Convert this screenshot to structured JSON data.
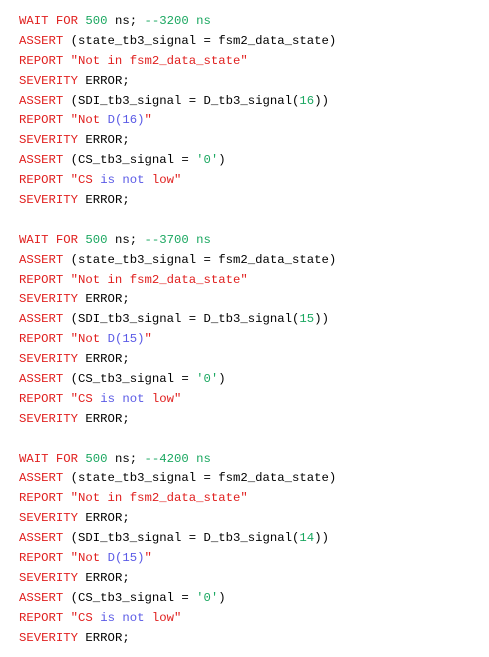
{
  "editor": {
    "lines": [
      [
        {
          "t": "WAIT FOR ",
          "c": "kw"
        },
        {
          "t": "500",
          "c": "num"
        },
        {
          "t": " ns",
          "c": "id"
        },
        {
          "t": "; ",
          "c": "op"
        },
        {
          "t": "--3200 ns",
          "c": "cmt"
        }
      ],
      [
        {
          "t": "ASSERT ",
          "c": "kw"
        },
        {
          "t": "(state_tb3_signal = fsm2_data_state)",
          "c": "id"
        }
      ],
      [
        {
          "t": "REPORT ",
          "c": "kw"
        },
        {
          "t": "\"Not in fsm2_data_state\"",
          "c": "str"
        }
      ],
      [
        {
          "t": "SEVERITY ",
          "c": "kw"
        },
        {
          "t": "ERROR",
          "c": "id"
        },
        {
          "t": ";",
          "c": "op"
        }
      ],
      [
        {
          "t": "ASSERT ",
          "c": "kw"
        },
        {
          "t": "(SDI_tb3_signal = D_tb3_signal(",
          "c": "id"
        },
        {
          "t": "16",
          "c": "num"
        },
        {
          "t": "))",
          "c": "id"
        }
      ],
      [
        {
          "t": "REPORT ",
          "c": "kw"
        },
        {
          "t": "\"Not ",
          "c": "str"
        },
        {
          "t": "D(16)",
          "c": "sd"
        },
        {
          "t": "\"",
          "c": "str"
        }
      ],
      [
        {
          "t": "SEVERITY ",
          "c": "kw"
        },
        {
          "t": "ERROR",
          "c": "id"
        },
        {
          "t": ";",
          "c": "op"
        }
      ],
      [
        {
          "t": "ASSERT ",
          "c": "kw"
        },
        {
          "t": "(CS_tb3_signal = ",
          "c": "id"
        },
        {
          "t": "'0'",
          "c": "num"
        },
        {
          "t": ")",
          "c": "id"
        }
      ],
      [
        {
          "t": "REPORT ",
          "c": "kw"
        },
        {
          "t": "\"CS ",
          "c": "str"
        },
        {
          "t": "is not",
          "c": "sd"
        },
        {
          "t": " low\"",
          "c": "str"
        }
      ],
      [
        {
          "t": "SEVERITY ",
          "c": "kw"
        },
        {
          "t": "ERROR",
          "c": "id"
        },
        {
          "t": ";",
          "c": "op"
        }
      ],
      [],
      [
        {
          "t": "WAIT FOR ",
          "c": "kw"
        },
        {
          "t": "500",
          "c": "num"
        },
        {
          "t": " ns",
          "c": "id"
        },
        {
          "t": "; ",
          "c": "op"
        },
        {
          "t": "--3700 ns",
          "c": "cmt"
        }
      ],
      [
        {
          "t": "ASSERT ",
          "c": "kw"
        },
        {
          "t": "(state_tb3_signal = fsm2_data_state)",
          "c": "id"
        }
      ],
      [
        {
          "t": "REPORT ",
          "c": "kw"
        },
        {
          "t": "\"Not in fsm2_data_state\"",
          "c": "str"
        }
      ],
      [
        {
          "t": "SEVERITY ",
          "c": "kw"
        },
        {
          "t": "ERROR",
          "c": "id"
        },
        {
          "t": ";",
          "c": "op"
        }
      ],
      [
        {
          "t": "ASSERT ",
          "c": "kw"
        },
        {
          "t": "(SDI_tb3_signal = D_tb3_signal(",
          "c": "id"
        },
        {
          "t": "15",
          "c": "num"
        },
        {
          "t": "))",
          "c": "id"
        }
      ],
      [
        {
          "t": "REPORT ",
          "c": "kw"
        },
        {
          "t": "\"Not ",
          "c": "str"
        },
        {
          "t": "D(15)",
          "c": "sd"
        },
        {
          "t": "\"",
          "c": "str"
        }
      ],
      [
        {
          "t": "SEVERITY ",
          "c": "kw"
        },
        {
          "t": "ERROR",
          "c": "id"
        },
        {
          "t": ";",
          "c": "op"
        }
      ],
      [
        {
          "t": "ASSERT ",
          "c": "kw"
        },
        {
          "t": "(CS_tb3_signal = ",
          "c": "id"
        },
        {
          "t": "'0'",
          "c": "num"
        },
        {
          "t": ")",
          "c": "id"
        }
      ],
      [
        {
          "t": "REPORT ",
          "c": "kw"
        },
        {
          "t": "\"CS ",
          "c": "str"
        },
        {
          "t": "is not",
          "c": "sd"
        },
        {
          "t": " low\"",
          "c": "str"
        }
      ],
      [
        {
          "t": "SEVERITY ",
          "c": "kw"
        },
        {
          "t": "ERROR",
          "c": "id"
        },
        {
          "t": ";",
          "c": "op"
        }
      ],
      [],
      [
        {
          "t": "WAIT FOR ",
          "c": "kw"
        },
        {
          "t": "500",
          "c": "num"
        },
        {
          "t": " ns",
          "c": "id"
        },
        {
          "t": "; ",
          "c": "op"
        },
        {
          "t": "--4200 ns",
          "c": "cmt"
        }
      ],
      [
        {
          "t": "ASSERT ",
          "c": "kw"
        },
        {
          "t": "(state_tb3_signal = fsm2_data_state)",
          "c": "id"
        }
      ],
      [
        {
          "t": "REPORT ",
          "c": "kw"
        },
        {
          "t": "\"Not in fsm2_data_state\"",
          "c": "str"
        }
      ],
      [
        {
          "t": "SEVERITY ",
          "c": "kw"
        },
        {
          "t": "ERROR",
          "c": "id"
        },
        {
          "t": ";",
          "c": "op"
        }
      ],
      [
        {
          "t": "ASSERT ",
          "c": "kw"
        },
        {
          "t": "(SDI_tb3_signal = D_tb3_signal(",
          "c": "id"
        },
        {
          "t": "14",
          "c": "num"
        },
        {
          "t": "))",
          "c": "id"
        }
      ],
      [
        {
          "t": "REPORT ",
          "c": "kw"
        },
        {
          "t": "\"Not ",
          "c": "str"
        },
        {
          "t": "D(15)",
          "c": "sd"
        },
        {
          "t": "\"",
          "c": "str"
        }
      ],
      [
        {
          "t": "SEVERITY ",
          "c": "kw"
        },
        {
          "t": "ERROR",
          "c": "id"
        },
        {
          "t": ";",
          "c": "op"
        }
      ],
      [
        {
          "t": "ASSERT ",
          "c": "kw"
        },
        {
          "t": "(CS_tb3_signal = ",
          "c": "id"
        },
        {
          "t": "'0'",
          "c": "num"
        },
        {
          "t": ")",
          "c": "id"
        }
      ],
      [
        {
          "t": "REPORT ",
          "c": "kw"
        },
        {
          "t": "\"CS ",
          "c": "str"
        },
        {
          "t": "is not",
          "c": "sd"
        },
        {
          "t": " low\"",
          "c": "str"
        }
      ],
      [
        {
          "t": "SEVERITY ",
          "c": "kw"
        },
        {
          "t": "ERROR",
          "c": "id"
        },
        {
          "t": ";",
          "c": "op"
        }
      ]
    ]
  },
  "colors": {
    "keyword": "#e0201f",
    "number": "#1aa760",
    "comment": "#1aa760",
    "string": "#e0201f",
    "string_embedded": "#5a5ae6",
    "identifier": "#000000",
    "background": "#ffffff"
  }
}
